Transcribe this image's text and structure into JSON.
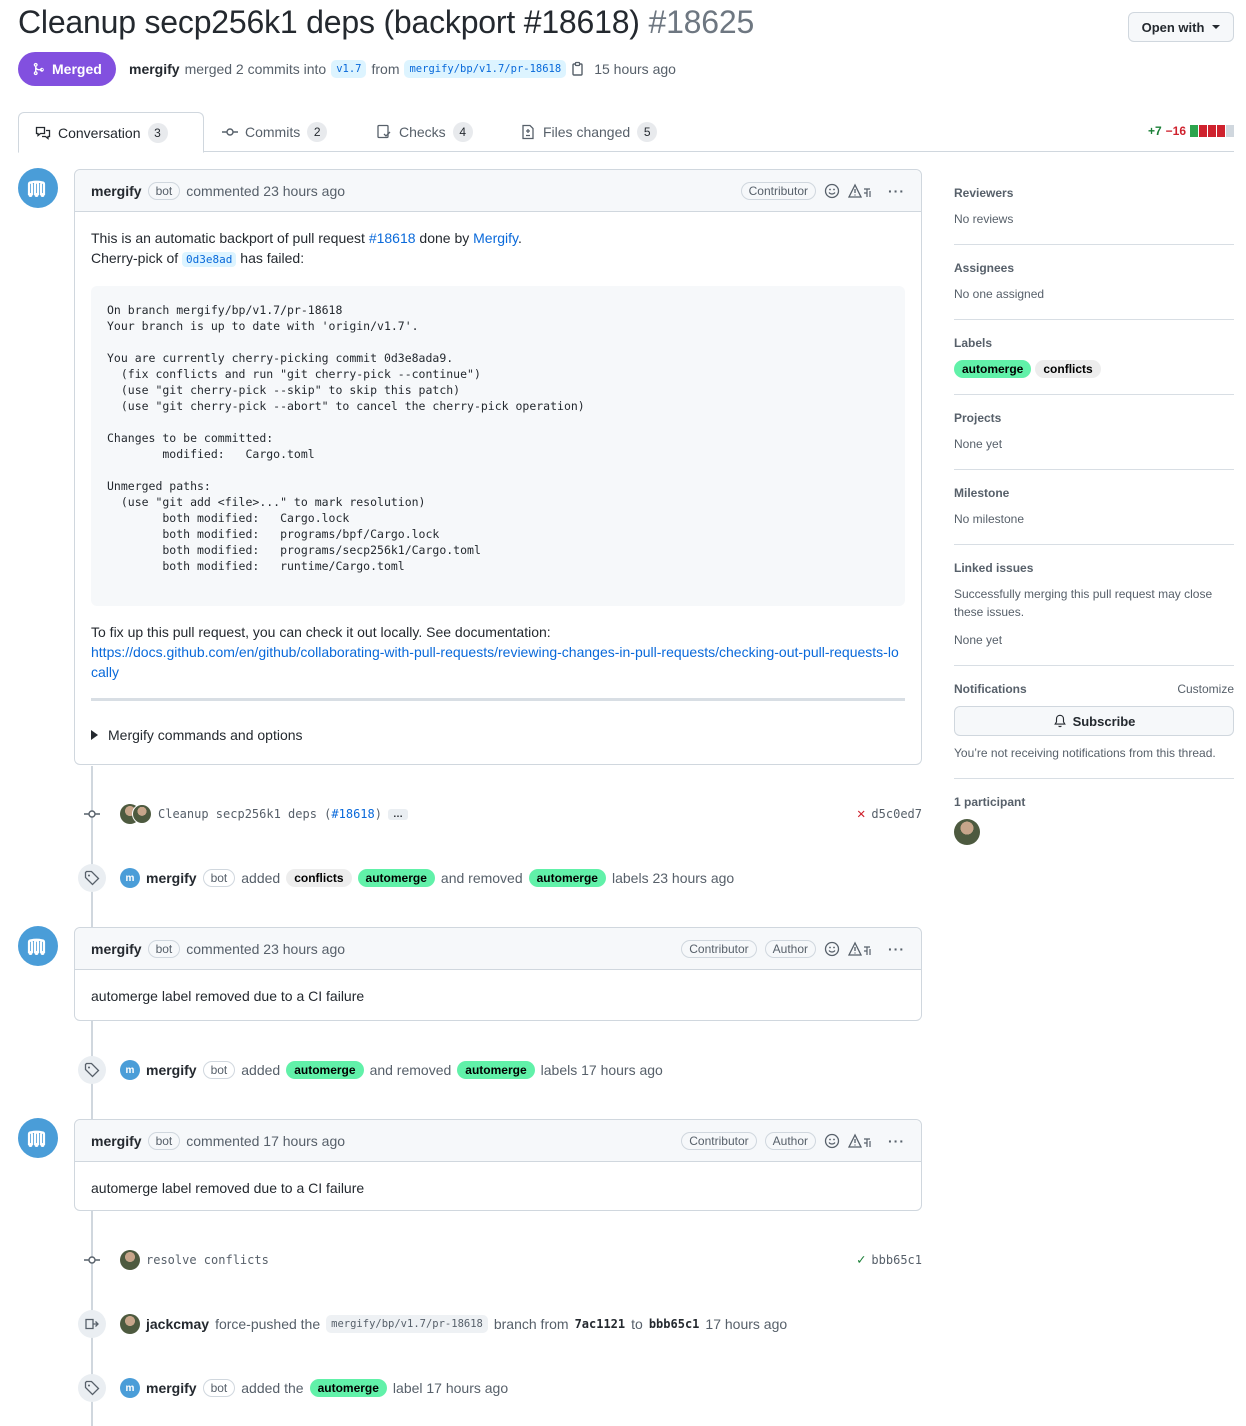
{
  "pr": {
    "title": "Cleanup secp256k1 deps (backport #18618)",
    "number": "#18625",
    "open_with": "Open with",
    "status": "Merged",
    "author": "mergify",
    "merge_text": "merged 2 commits into",
    "base_branch": "v1.7",
    "from_text": "from",
    "head_branch": "mergify/bp/v1.7/pr-18618",
    "time": "15 hours ago"
  },
  "tabs": [
    {
      "label": "Conversation",
      "count": "3"
    },
    {
      "label": "Commits",
      "count": "2"
    },
    {
      "label": "Checks",
      "count": "4"
    },
    {
      "label": "Files changed",
      "count": "5"
    }
  ],
  "diffstat": {
    "additions": "+7",
    "deletions": "−16"
  },
  "colors": {
    "merged": "#8250df",
    "label_automerge": "#61f1a9",
    "label_conflicts": "#ededed",
    "link": "#0969da"
  },
  "comment1": {
    "author": "mergify",
    "bot": "bot",
    "time": "commented 23 hours ago",
    "role": "Contributor",
    "intro_prefix": "This is an automatic backport of pull request",
    "intro_pr_link": "#18618",
    "intro_mid": "done by",
    "intro_link": "Mergify",
    "intro_suffix": ".",
    "cherry_prefix": "Cherry-pick of",
    "cherry_sha": "0d3e8ad",
    "cherry_suffix": "has failed:",
    "code": "On branch mergify/bp/v1.7/pr-18618\nYour branch is up to date with 'origin/v1.7'.\n\nYou are currently cherry-picking commit 0d3e8ada9.\n  (fix conflicts and run \"git cherry-pick --continue\")\n  (use \"git cherry-pick --skip\" to skip this patch)\n  (use \"git cherry-pick --abort\" to cancel the cherry-pick operation)\n\nChanges to be committed:\n        modified:   Cargo.toml\n\nUnmerged paths:\n  (use \"git add <file>...\" to mark resolution)\n        both modified:   Cargo.lock\n        both modified:   programs/bpf/Cargo.lock\n        both modified:   programs/secp256k1/Cargo.toml\n        both modified:   runtime/Cargo.toml",
    "fix_text": "To fix up this pull request, you can check it out locally. See documentation:",
    "doc_link": "https://docs.github.com/en/github/collaborating-with-pull-requests/reviewing-changes-in-pull-requests/checking-out-pull-requests-locally",
    "details": "Mergify commands and options"
  },
  "commit1": {
    "message": "Cleanup secp256k1 deps (",
    "pr_link": "#18618",
    "message_end": ")",
    "ellipsis": "…",
    "sha": "d5c0ed7"
  },
  "label_event1": {
    "author": "mergify",
    "bot": "bot",
    "added": "added",
    "label_a": "conflicts",
    "label_b": "automerge",
    "removed": "and removed",
    "label_c": "automerge",
    "suffix": "labels 23 hours ago"
  },
  "comment2": {
    "author": "mergify",
    "bot": "bot",
    "time": "commented 23 hours ago",
    "role": "Contributor",
    "role2": "Author",
    "body": "automerge label removed due to a CI failure"
  },
  "label_event2": {
    "author": "mergify",
    "bot": "bot",
    "added": "added",
    "label_a": "automerge",
    "removed": "and removed",
    "label_b": "automerge",
    "suffix": "labels 17 hours ago"
  },
  "comment3": {
    "author": "mergify",
    "bot": "bot",
    "time": "commented 17 hours ago",
    "role": "Contributor",
    "role2": "Author",
    "body": "automerge label removed due to a CI failure"
  },
  "commit2": {
    "message": "resolve conflicts",
    "sha": "bbb65c1"
  },
  "force_push": {
    "author": "jackcmay",
    "text": "force-pushed the",
    "branch": "mergify/bp/v1.7/pr-18618",
    "from_text": "branch from",
    "from_sha": "7ac1121",
    "to_text": "to",
    "to_sha": "bbb65c1",
    "time": "17 hours ago"
  },
  "label_event3": {
    "author": "mergify",
    "bot": "bot",
    "text": "added the",
    "label": "automerge",
    "suffix": "label 17 hours ago"
  },
  "sidebar": {
    "reviewers": {
      "title": "Reviewers",
      "value": "No reviews"
    },
    "assignees": {
      "title": "Assignees",
      "value": "No one assigned"
    },
    "labels": {
      "title": "Labels",
      "items": [
        "automerge",
        "conflicts"
      ]
    },
    "projects": {
      "title": "Projects",
      "value": "None yet"
    },
    "milestone": {
      "title": "Milestone",
      "value": "No milestone"
    },
    "linked": {
      "title": "Linked issues",
      "desc": "Successfully merging this pull request may close these issues.",
      "value": "None yet"
    },
    "notifications": {
      "title": "Notifications",
      "customize": "Customize",
      "subscribe": "Subscribe",
      "desc": "You’re not receiving notifications from this thread."
    },
    "participants": {
      "title": "1 participant"
    }
  }
}
